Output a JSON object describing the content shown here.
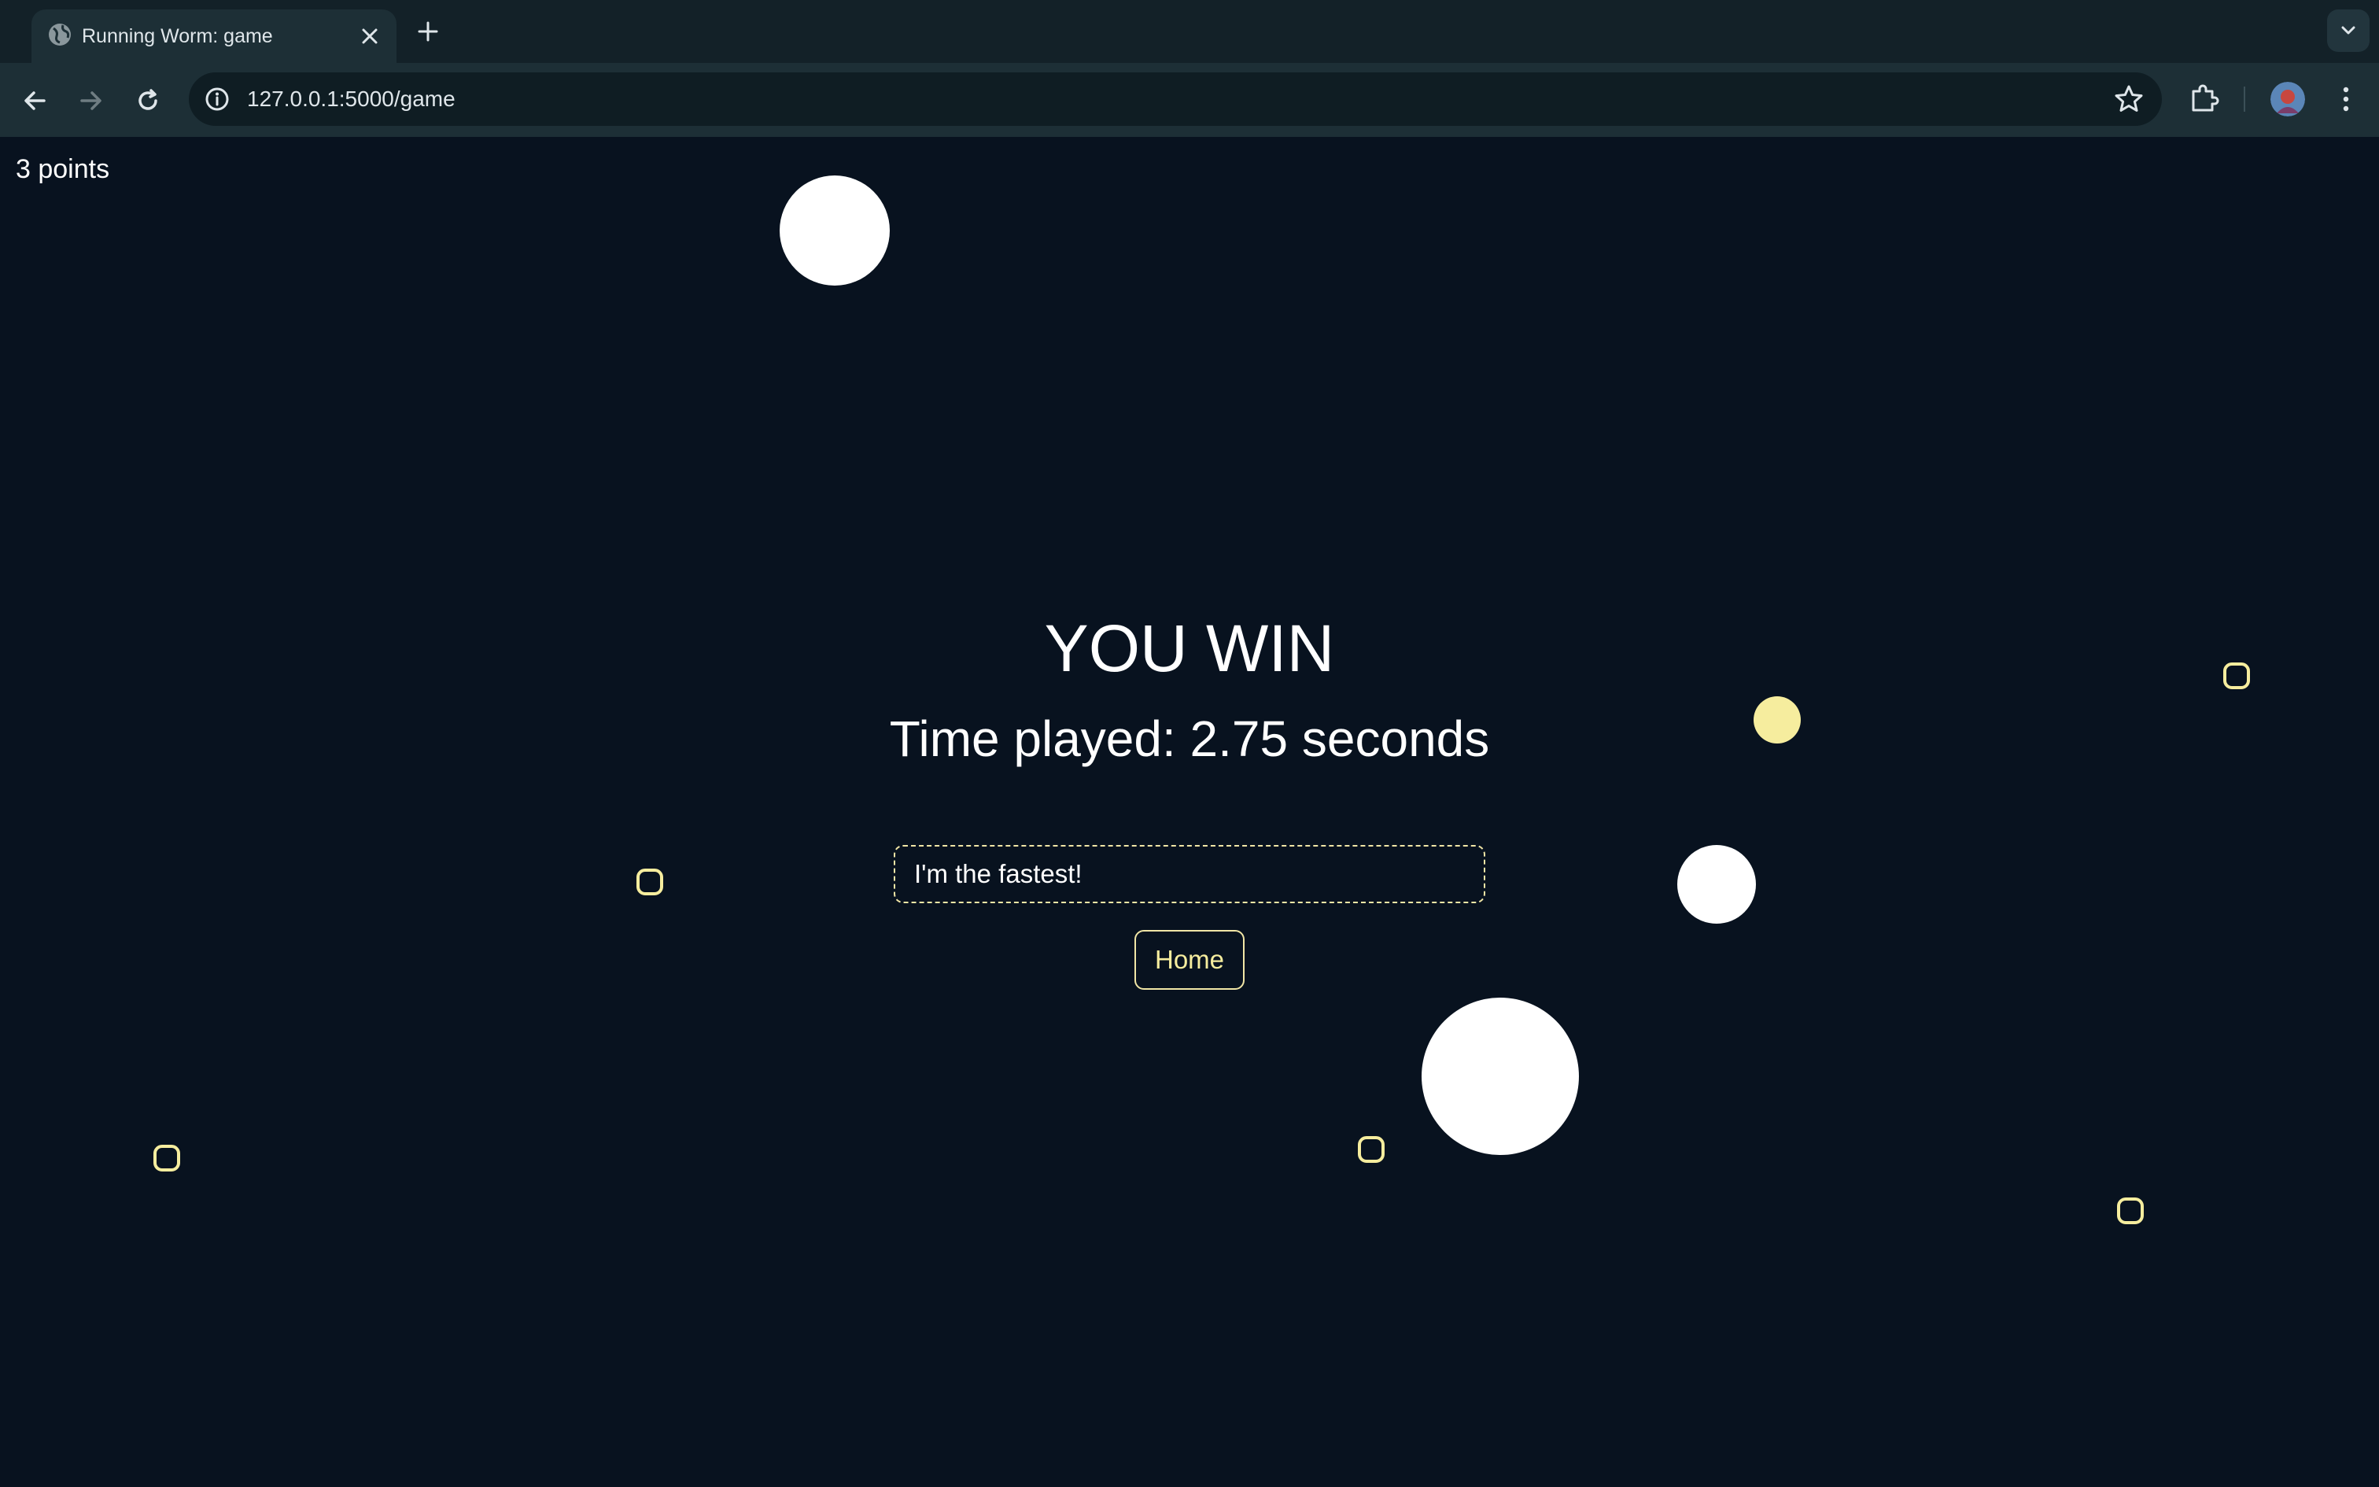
{
  "browser": {
    "tab_title": "Running Worm: game",
    "url": "127.0.0.1:5000/game"
  },
  "game": {
    "score_label": "3 points",
    "result_title": "YOU WIN",
    "time_played": "Time played: 2.75 seconds",
    "name_input_value": "I'm the fastest!",
    "home_button_label": "Home",
    "colors": {
      "background": "#08121f",
      "accent": "#f6ed9e",
      "ball": "#ffffff"
    },
    "icons": [
      "globe-icon",
      "close-icon",
      "plus-icon",
      "back-arrow-icon",
      "forward-arrow-icon",
      "reload-icon",
      "info-icon",
      "star-icon",
      "puzzle-icon",
      "avatar",
      "kebab-menu-icon",
      "chevron-down-icon"
    ]
  }
}
